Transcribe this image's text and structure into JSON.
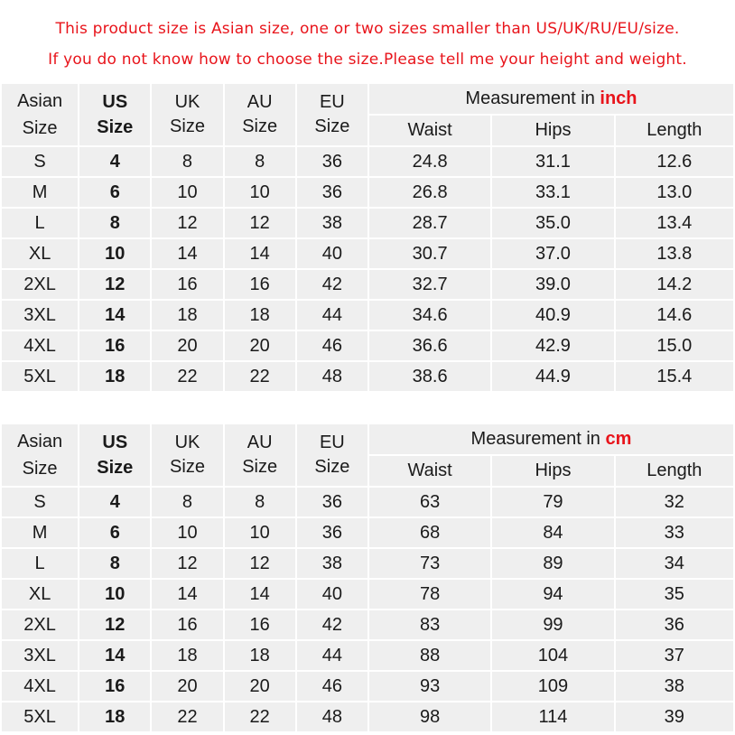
{
  "notice": {
    "line1": "This product size is Asian size, one or two sizes smaller than US/UK/RU/EU/size.",
    "line2": "If you do not know how to choose the size.Please tell me your height and weight."
  },
  "headers": {
    "asian": [
      "Asian",
      "Size"
    ],
    "us": [
      "US",
      "Size"
    ],
    "uk": [
      "UK",
      "Size"
    ],
    "au": [
      "AU",
      "Size"
    ],
    "eu": [
      "EU",
      "Size"
    ],
    "measurement_prefix": "Measurement in",
    "waist": "Waist",
    "hips": "Hips",
    "length": "Length"
  },
  "colors": {
    "notice": "#e8141b",
    "inch_header": "#ffccff",
    "cm_header": "#ccffcc",
    "cell": "#efefef"
  },
  "tables": [
    {
      "unit": "inch",
      "rows": [
        {
          "asian": "S",
          "us": "4",
          "uk": "8",
          "au": "8",
          "eu": "36",
          "waist": "24.8",
          "hips": "31.1",
          "length": "12.6"
        },
        {
          "asian": "M",
          "us": "6",
          "uk": "10",
          "au": "10",
          "eu": "36",
          "waist": "26.8",
          "hips": "33.1",
          "length": "13.0"
        },
        {
          "asian": "L",
          "us": "8",
          "uk": "12",
          "au": "12",
          "eu": "38",
          "waist": "28.7",
          "hips": "35.0",
          "length": "13.4"
        },
        {
          "asian": "XL",
          "us": "10",
          "uk": "14",
          "au": "14",
          "eu": "40",
          "waist": "30.7",
          "hips": "37.0",
          "length": "13.8"
        },
        {
          "asian": "2XL",
          "us": "12",
          "uk": "16",
          "au": "16",
          "eu": "42",
          "waist": "32.7",
          "hips": "39.0",
          "length": "14.2"
        },
        {
          "asian": "3XL",
          "us": "14",
          "uk": "18",
          "au": "18",
          "eu": "44",
          "waist": "34.6",
          "hips": "40.9",
          "length": "14.6"
        },
        {
          "asian": "4XL",
          "us": "16",
          "uk": "20",
          "au": "20",
          "eu": "46",
          "waist": "36.6",
          "hips": "42.9",
          "length": "15.0"
        },
        {
          "asian": "5XL",
          "us": "18",
          "uk": "22",
          "au": "22",
          "eu": "48",
          "waist": "38.6",
          "hips": "44.9",
          "length": "15.4"
        }
      ]
    },
    {
      "unit": "cm",
      "rows": [
        {
          "asian": "S",
          "us": "4",
          "uk": "8",
          "au": "8",
          "eu": "36",
          "waist": "63",
          "hips": "79",
          "length": "32"
        },
        {
          "asian": "M",
          "us": "6",
          "uk": "10",
          "au": "10",
          "eu": "36",
          "waist": "68",
          "hips": "84",
          "length": "33"
        },
        {
          "asian": "L",
          "us": "8",
          "uk": "12",
          "au": "12",
          "eu": "38",
          "waist": "73",
          "hips": "89",
          "length": "34"
        },
        {
          "asian": "XL",
          "us": "10",
          "uk": "14",
          "au": "14",
          "eu": "40",
          "waist": "78",
          "hips": "94",
          "length": "35"
        },
        {
          "asian": "2XL",
          "us": "12",
          "uk": "16",
          "au": "16",
          "eu": "42",
          "waist": "83",
          "hips": "99",
          "length": "36"
        },
        {
          "asian": "3XL",
          "us": "14",
          "uk": "18",
          "au": "18",
          "eu": "44",
          "waist": "88",
          "hips": "104",
          "length": "37"
        },
        {
          "asian": "4XL",
          "us": "16",
          "uk": "20",
          "au": "20",
          "eu": "46",
          "waist": "93",
          "hips": "109",
          "length": "38"
        },
        {
          "asian": "5XL",
          "us": "18",
          "uk": "22",
          "au": "22",
          "eu": "48",
          "waist": "98",
          "hips": "114",
          "length": "39"
        }
      ]
    }
  ]
}
